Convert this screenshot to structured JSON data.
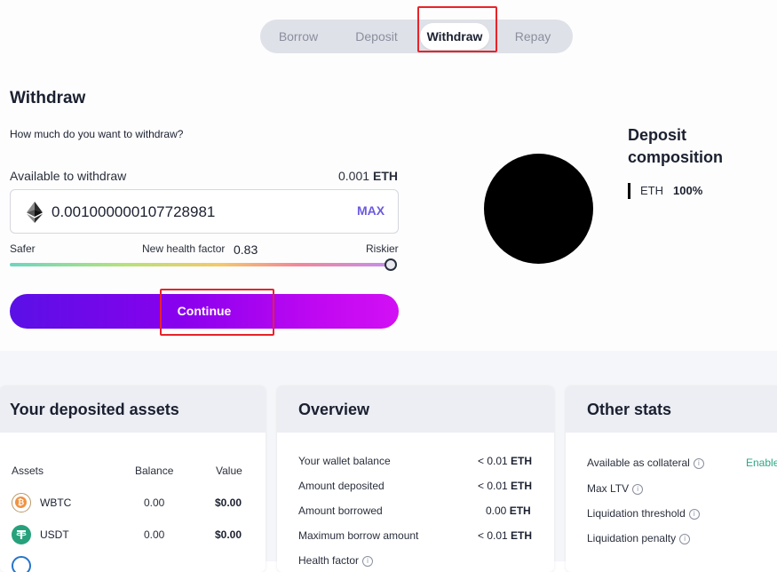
{
  "tabs": [
    {
      "label": "Borrow"
    },
    {
      "label": "Deposit"
    },
    {
      "label": "Withdraw",
      "active": true
    },
    {
      "label": "Repay"
    }
  ],
  "withdraw": {
    "title": "Withdraw",
    "question": "How much do you want to withdraw?",
    "available_label": "Available to withdraw",
    "available_amount": "0.001",
    "available_unit": "ETH",
    "amount_value": "0.001000000107728981",
    "asset_icon": "ethereum-icon",
    "max_label": "MAX",
    "safer_label": "Safer",
    "health_label": "New health factor",
    "health_value": "0.83",
    "riskier_label": "Riskier",
    "health_slider_level": 1.0,
    "continue_label": "Continue"
  },
  "composition": {
    "title": "Deposit composition",
    "items": [
      {
        "asset": "ETH",
        "percent": "100%",
        "color": "#000000",
        "share": 1.0
      }
    ]
  },
  "deposited_assets": {
    "title": "Your deposited assets",
    "headers": {
      "assets": "Assets",
      "balance": "Balance",
      "value": "Value"
    },
    "rows": [
      {
        "name": "WBTC",
        "balance": "0.00",
        "value": "$0.00",
        "icon": "wbtc-icon"
      },
      {
        "name": "USDT",
        "balance": "0.00",
        "value": "$0.00",
        "icon": "usdt-icon"
      }
    ]
  },
  "overview": {
    "title": "Overview",
    "rows": [
      {
        "label": "Your wallet balance",
        "value": "< 0.01",
        "unit": "ETH"
      },
      {
        "label": "Amount deposited",
        "value": "< 0.01",
        "unit": "ETH"
      },
      {
        "label": "Amount borrowed",
        "value": "0.00",
        "unit": "ETH"
      },
      {
        "label": "Maximum borrow amount",
        "value": "< 0.01",
        "unit": "ETH"
      },
      {
        "label": "Health factor"
      }
    ]
  },
  "other_stats": {
    "title": "Other stats",
    "rows": [
      {
        "label": "Available as collateral",
        "value": "Enable"
      },
      {
        "label": "Max LTV"
      },
      {
        "label": "Liquidation threshold"
      },
      {
        "label": "Liquidation penalty"
      }
    ]
  },
  "colors": {
    "accent": "#6c5be0",
    "button_gradient_start": "#5a10e6",
    "button_gradient_end": "#d210f4",
    "highlight_box": "#e8232a",
    "enable_green": "#2aa883"
  }
}
